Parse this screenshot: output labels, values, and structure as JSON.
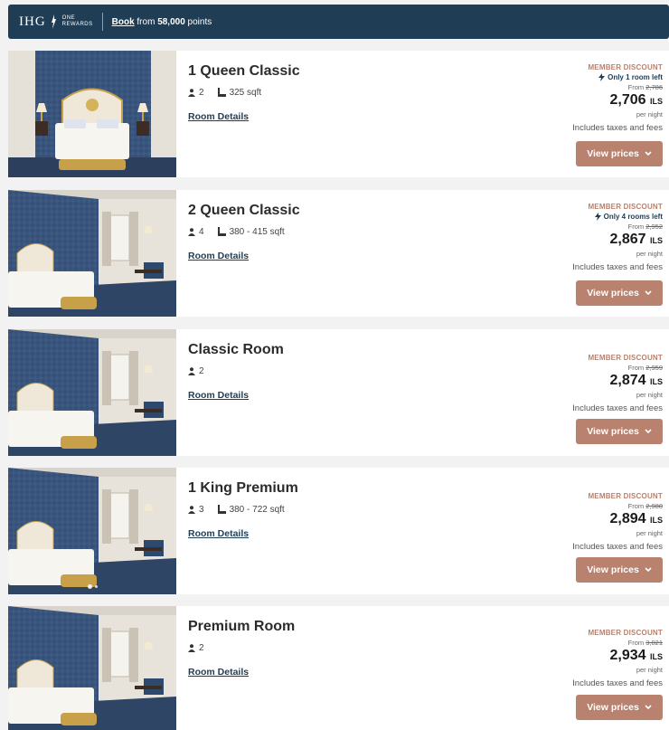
{
  "banner": {
    "logo_main": "IHG",
    "logo_sub_line1": "ONE",
    "logo_sub_line2": "REWARDS",
    "book_label": "Book",
    "from_label": " from ",
    "points": "58,000",
    "points_suffix": " points"
  },
  "rooms": [
    {
      "name": "1 Queen Classic",
      "guests": "2",
      "size": "325 sqft",
      "details_label": "Room Details",
      "discount_label": "MEMBER DISCOUNT",
      "scarcity": "Only 1 room left",
      "from_label": "From",
      "original_price": "2,786",
      "price": "2,706",
      "currency": "ILS",
      "per_night": "per night",
      "taxes": "Includes taxes and fees",
      "button_label": "View prices"
    },
    {
      "name": "2 Queen Classic",
      "guests": "4",
      "size": "380 - 415 sqft",
      "details_label": "Room Details",
      "discount_label": "MEMBER DISCOUNT",
      "scarcity": "Only 4 rooms left",
      "from_label": "From",
      "original_price": "2,952",
      "price": "2,867",
      "currency": "ILS",
      "per_night": "per night",
      "taxes": "Includes taxes and fees",
      "button_label": "View prices"
    },
    {
      "name": "Classic Room",
      "guests": "2",
      "size": "",
      "details_label": "Room Details",
      "discount_label": "MEMBER DISCOUNT",
      "scarcity": "",
      "from_label": "From",
      "original_price": "2,959",
      "price": "2,874",
      "currency": "ILS",
      "per_night": "per night",
      "taxes": "Includes taxes and fees",
      "button_label": "View prices"
    },
    {
      "name": "1 King Premium",
      "guests": "3",
      "size": "380 - 722 sqft",
      "details_label": "Room Details",
      "discount_label": "MEMBER DISCOUNT",
      "scarcity": "",
      "from_label": "From",
      "original_price": "2,980",
      "price": "2,894",
      "currency": "ILS",
      "per_night": "per night",
      "taxes": "Includes taxes and fees",
      "button_label": "View prices"
    },
    {
      "name": "Premium Room",
      "guests": "2",
      "size": "",
      "details_label": "Room Details",
      "discount_label": "MEMBER DISCOUNT",
      "scarcity": "",
      "from_label": "From",
      "original_price": "3,021",
      "price": "2,934",
      "currency": "ILS",
      "per_night": "per night",
      "taxes": "Includes taxes and fees",
      "button_label": "View prices"
    }
  ],
  "icons": {
    "guests": "person-icon",
    "size": "floor-area-icon",
    "scarcity": "lightning-icon",
    "button": "chevron-down-icon"
  },
  "colors": {
    "banner": "#1f3d55",
    "accent": "#b8826e",
    "link": "#1f3d55"
  }
}
